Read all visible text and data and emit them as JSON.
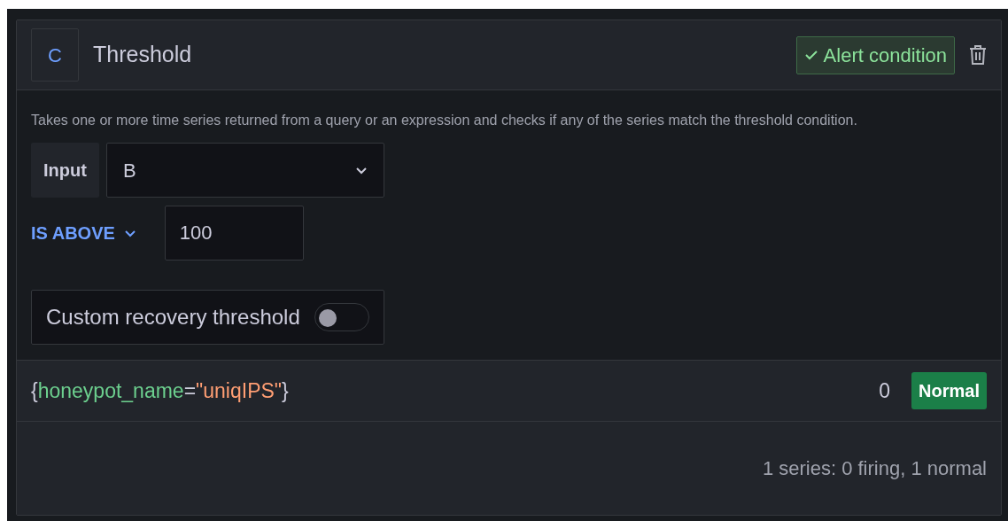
{
  "query": {
    "ref_id": "C",
    "title": "Threshold",
    "alert_condition": {
      "label": "Alert condition",
      "selected": true
    }
  },
  "description": "Takes one or more time series returned from a query or an expression and checks if any of the series match the threshold condition.",
  "input": {
    "label": "Input",
    "value": "B"
  },
  "condition": {
    "operator": "IS ABOVE",
    "value": "100"
  },
  "recovery": {
    "label": "Custom recovery threshold",
    "on": false
  },
  "series": [
    {
      "label_parts": [
        {
          "kind": "punct",
          "text": "{"
        },
        {
          "kind": "key",
          "text": "honeypot_name"
        },
        {
          "kind": "punct",
          "text": "="
        },
        {
          "kind": "value",
          "text": "\"uniqIPS\""
        },
        {
          "kind": "punct",
          "text": "}"
        }
      ],
      "value": "0",
      "state": "Normal"
    }
  ],
  "summary": "1 series: 0 firing, 1 normal"
}
